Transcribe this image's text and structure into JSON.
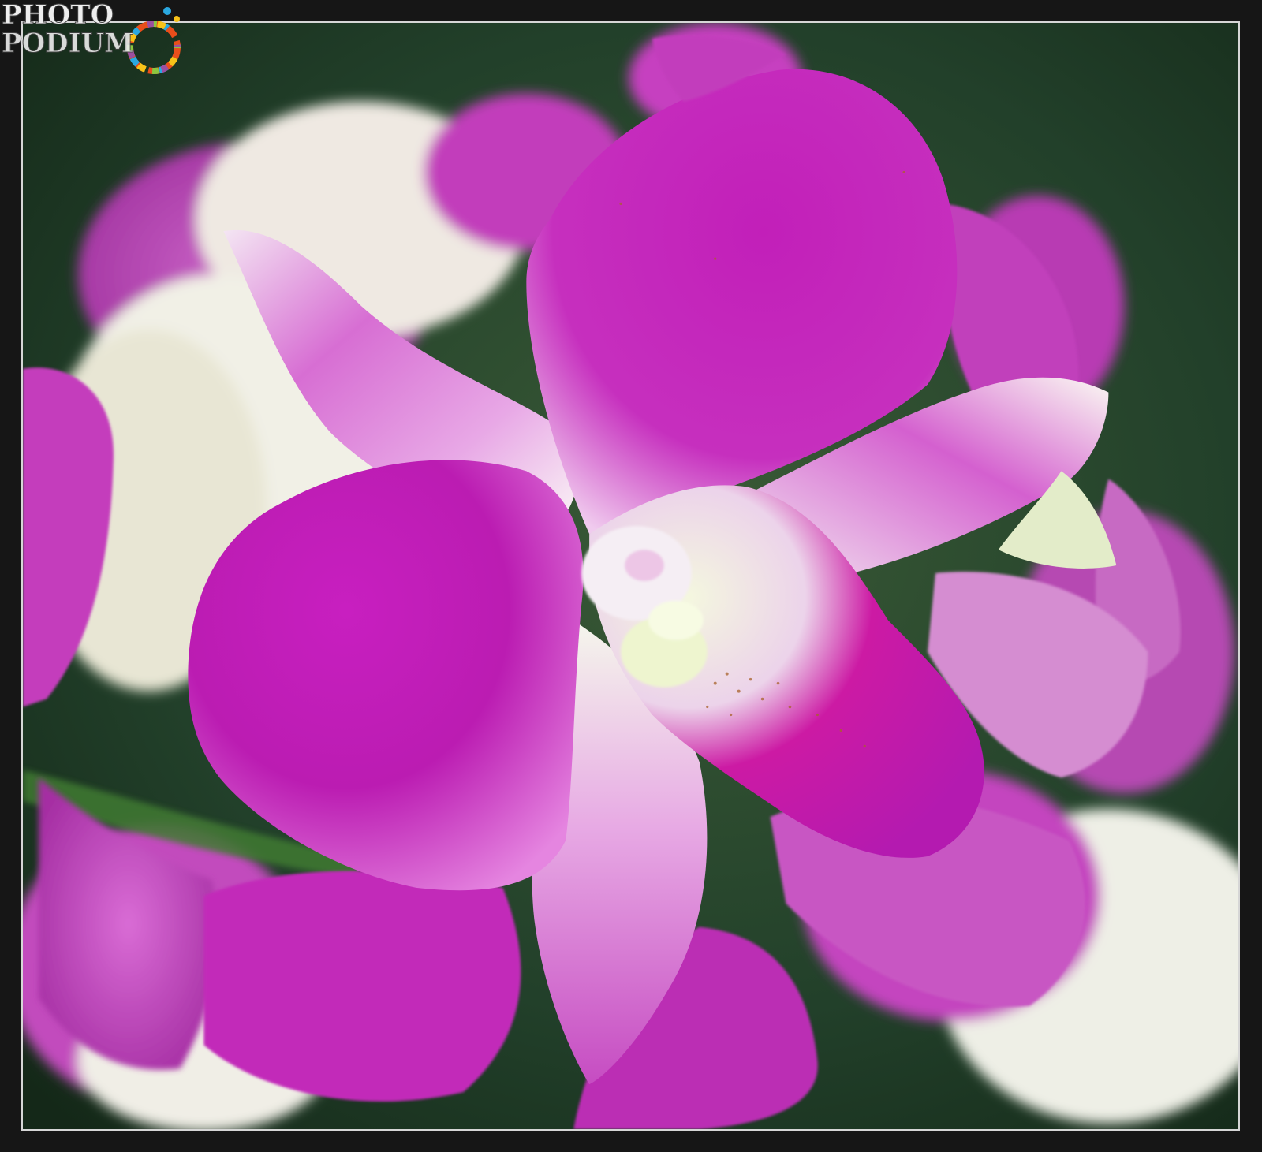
{
  "logo": {
    "line1": "PHOTO",
    "line2": "PODIUM",
    "icon": "rainbow-dots-ring-icon"
  },
  "photo": {
    "subject_icon": "orchid-flower-photo",
    "colors": {
      "petal_main": "#c21fb8",
      "petal_light": "#e48de0",
      "petal_white": "#f3f1f0",
      "column_cream": "#f1f6d8",
      "background_green": "#23422a",
      "frame": "#161616",
      "border": "#d6d6d6"
    }
  }
}
